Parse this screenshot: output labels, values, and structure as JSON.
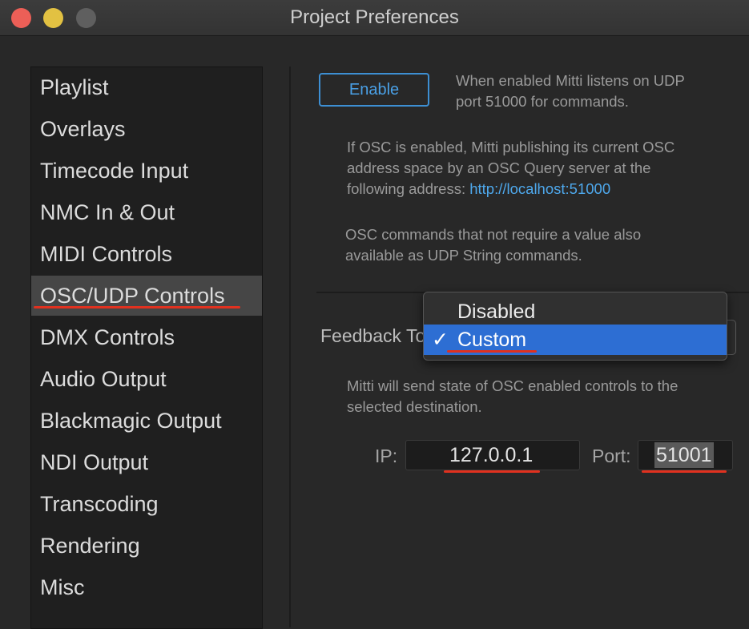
{
  "window": {
    "title": "Project Preferences"
  },
  "sidebar": {
    "items": [
      {
        "label": "Playlist"
      },
      {
        "label": "Overlays"
      },
      {
        "label": "Timecode Input"
      },
      {
        "label": "NMC In & Out"
      },
      {
        "label": "MIDI Controls"
      },
      {
        "label": "OSC/UDP Controls",
        "selected": true
      },
      {
        "label": "DMX Controls"
      },
      {
        "label": "Audio Output"
      },
      {
        "label": "Blackmagic Output"
      },
      {
        "label": "NDI Output"
      },
      {
        "label": "Transcoding"
      },
      {
        "label": "Rendering"
      },
      {
        "label": "Misc"
      }
    ]
  },
  "main": {
    "enable_label": "Enable",
    "udp_info_line1": "When enabled Mitti listens on UDP",
    "udp_info_line2": "port 51000 for commands.",
    "osc_info_line1": "If OSC is enabled, Mitti publishing its current OSC",
    "osc_info_line2": "address space by an OSC Query server at the",
    "osc_info_line3": "following address:",
    "osc_query_url": "http://localhost:51000",
    "udp_string_line1": "OSC commands that not require a value also",
    "udp_string_line2": "available as UDP String commands.",
    "feedback_label": "Feedback To:",
    "feedback_options": [
      "Disabled",
      "Custom"
    ],
    "feedback_selected": "Custom",
    "checkmark": "✓",
    "feedback_info_line1": "Mitti will send state of OSC enabled controls to the",
    "feedback_info_line2": "selected destination.",
    "ip_label": "IP:",
    "ip_value": "127.0.0.1",
    "port_label": "Port:",
    "port_value": "51001"
  },
  "colors": {
    "accent": "#2d6ed3",
    "link": "#4ea8ec",
    "annotation": "#e1311f"
  }
}
